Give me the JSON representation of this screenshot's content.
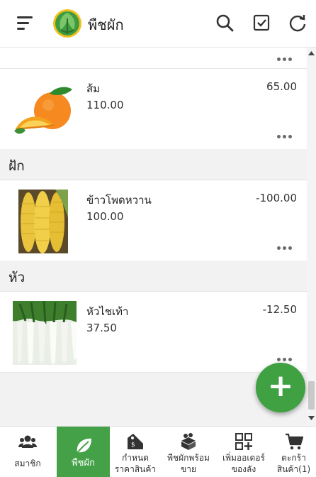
{
  "app": {
    "title": "พืชผัก"
  },
  "colors": {
    "accent": "#44a147",
    "fab": "#3fa142",
    "section_bg": "#f2f2f2"
  },
  "toolbar": {
    "icons": [
      "menu-icon",
      "search-icon",
      "checkbox-icon",
      "refresh-icon"
    ]
  },
  "sections": [
    {
      "header": "",
      "items": [
        {
          "name": "ส้ม",
          "qty": "110.00",
          "price": "65.00",
          "image": "orange"
        }
      ]
    },
    {
      "header": "ฝัก",
      "items": [
        {
          "name": "ข้าวโพดหวาน",
          "qty": "100.00",
          "price": "-100.00",
          "image": "corn"
        }
      ]
    },
    {
      "header": "หัว",
      "items": [
        {
          "name": "หัวไชเท้า",
          "qty": "37.50",
          "price": "-12.50",
          "image": "radish"
        }
      ]
    }
  ],
  "fab": {
    "label": "+"
  },
  "bottom_nav": [
    {
      "label": "สมาชิก",
      "icon": "members-icon"
    },
    {
      "label": "พืชผัก",
      "icon": "leaf-icon",
      "active": true
    },
    {
      "label": "กำหนด ราคาสินค้า",
      "icon": "price-tag-icon"
    },
    {
      "label": "พืชผักพร้อม ขาย",
      "icon": "produce-box-icon"
    },
    {
      "label": "เพิ่มออเดอร์ ของลัง",
      "icon": "add-order-icon"
    },
    {
      "label": "ตะกร้า สินค้า(1)",
      "icon": "cart-icon"
    }
  ]
}
